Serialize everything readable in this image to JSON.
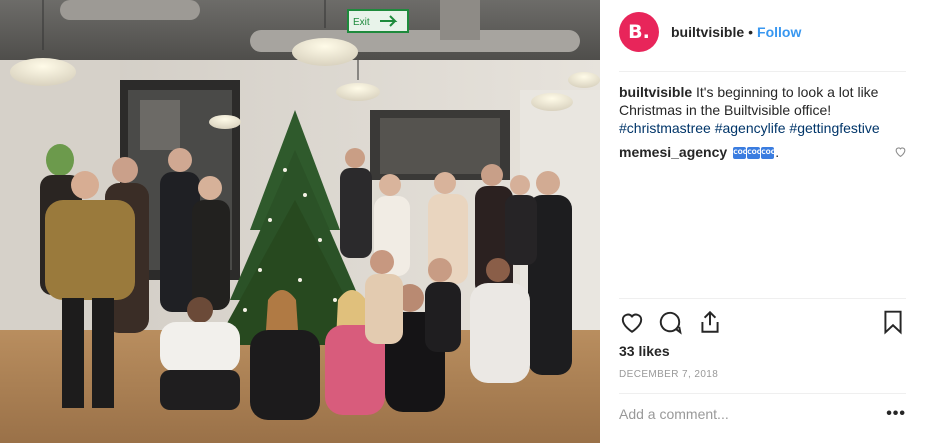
{
  "post": {
    "username": "builtvisible",
    "avatar_letter": "B.",
    "follow_label": "Follow",
    "dot": "•",
    "caption_text": "It's beginning to look a lot like Christmas in the Builtvisible office!",
    "hashtags": [
      "#christmastree",
      "#agencylife",
      "#gettingfestive"
    ],
    "likes": "33 likes",
    "date": "DECEMBER 7, 2018",
    "add_comment_placeholder": "Add a comment...",
    "more_label": "•••"
  },
  "photo": {
    "exit_sign": "Exit",
    "description_icon": "group-photo"
  },
  "comments": [
    {
      "username": "memesi_agency",
      "emoji_label": "COOL",
      "emoji_count": 3,
      "suffix": "."
    }
  ],
  "colors": {
    "brand": "#e8255a",
    "follow": "#3897f0",
    "hashtag": "#003569"
  }
}
